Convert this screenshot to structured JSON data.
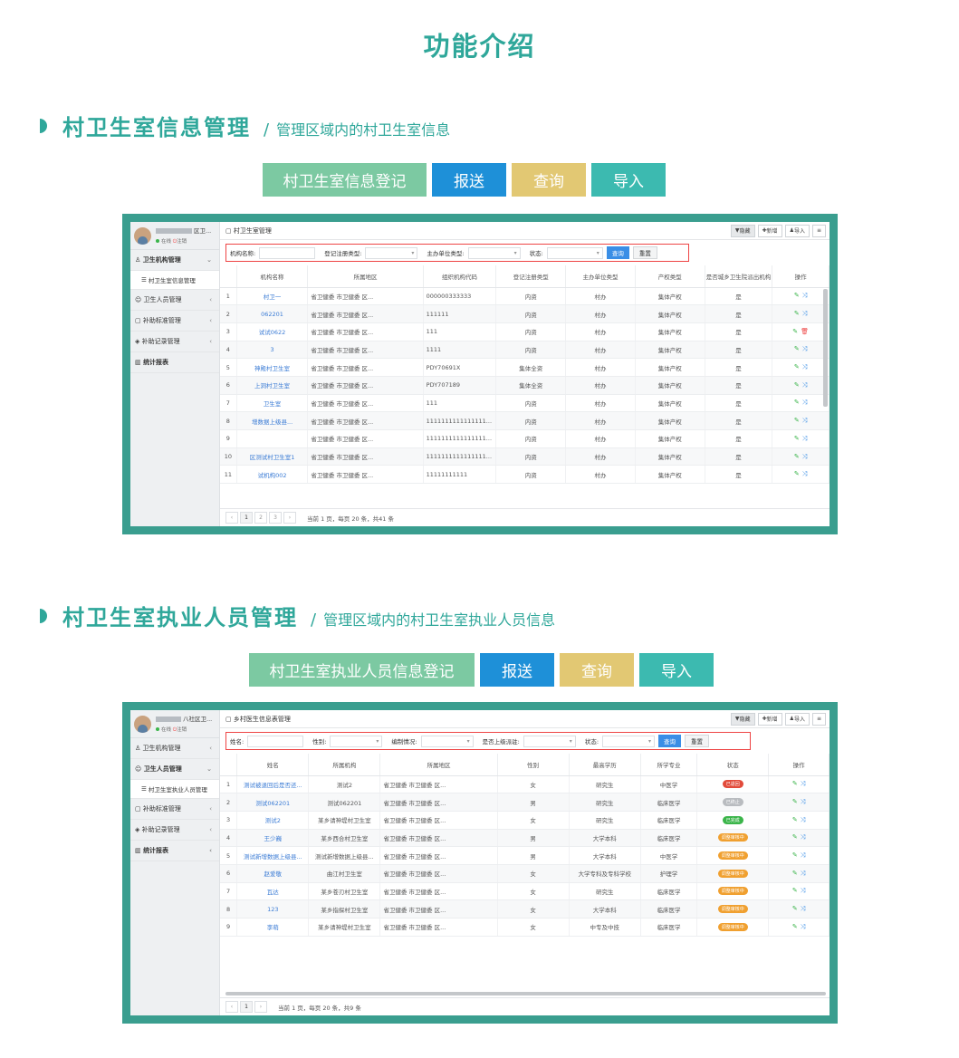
{
  "page_title": "功能介绍",
  "colors": {
    "teal": "#2fa79a",
    "green_btn": "#7cc9a2",
    "blue_btn": "#1e90d8",
    "yellow_btn": "#e2c873",
    "cyan_btn": "#3cbab0"
  },
  "section1": {
    "title": "村卫生室信息管理",
    "slash": "/",
    "subtitle": "管理区域内的村卫生室信息",
    "buttons": {
      "register": "村卫生室信息登记",
      "report": "报送",
      "query": "查询",
      "import": "导入"
    },
    "app": {
      "user": {
        "name": "区卫...",
        "online": "在线",
        "logout": "注销"
      },
      "menu": {
        "org_mgmt": "卫生机构管理",
        "org_sub": "村卫生室信息管理",
        "staff_mgmt": "卫生人员管理",
        "subsidy_std": "补助标准管理",
        "subsidy_rec": "补助记录管理",
        "stats": "统计报表"
      },
      "breadcrumb": "村卫生室管理",
      "toolbar": {
        "hide": "隐藏",
        "add": "新增",
        "import": "导入"
      },
      "filter": {
        "org_name": "机构名称:",
        "reg_type": "登记注册类型:",
        "unit_type": "主办单位类型:",
        "status": "状态:",
        "query": "查询",
        "reset": "重置"
      },
      "columns": [
        "",
        "机构名称",
        "所属地区",
        "组织机构代码",
        "登记注册类型",
        "主办单位类型",
        "产权类型",
        "是否城乡卫生院派出机构",
        "操作"
      ],
      "rows": [
        {
          "n": "1",
          "name": "村卫一",
          "region": "省卫健委 市卫健委 区...",
          "code": "000000333333",
          "reg": "内资",
          "unit": "村办",
          "prop": "集体产权",
          "sent": "是"
        },
        {
          "n": "2",
          "name": "062201",
          "region": "省卫健委 市卫健委 区...",
          "code": "111111",
          "reg": "内资",
          "unit": "村办",
          "prop": "集体产权",
          "sent": "是"
        },
        {
          "n": "3",
          "name": "试试0622",
          "region": "省卫健委 市卫健委 区...",
          "code": "111",
          "reg": "内资",
          "unit": "村办",
          "prop": "集体产权",
          "sent": "是"
        },
        {
          "n": "4",
          "name": "3",
          "region": "省卫健委 市卫健委 区...",
          "code": "1111",
          "reg": "内资",
          "unit": "村办",
          "prop": "集体产权",
          "sent": "是"
        },
        {
          "n": "5",
          "name": "神殿村卫生室",
          "region": "省卫健委 市卫健委 区...",
          "code": "PDY70691X",
          "reg": "集体全资",
          "unit": "村办",
          "prop": "集体产权",
          "sent": "是"
        },
        {
          "n": "6",
          "name": "上洞村卫生室",
          "region": "省卫健委 市卫健委 区...",
          "code": "PDY707189",
          "reg": "集体全资",
          "unit": "村办",
          "prop": "集体产权",
          "sent": "是"
        },
        {
          "n": "7",
          "name": "卫生室",
          "region": "省卫健委 市卫健委 区...",
          "code": "111",
          "reg": "内资",
          "unit": "村办",
          "prop": "集体产权",
          "sent": "是"
        },
        {
          "n": "8",
          "name": "增数据上级县...",
          "region": "省卫健委 市卫健委 区...",
          "code": "1111111111111111...",
          "reg": "内资",
          "unit": "村办",
          "prop": "集体产权",
          "sent": "是"
        },
        {
          "n": "9",
          "name": "",
          "region": "省卫健委 市卫健委 区...",
          "code": "1111111111111111...",
          "reg": "内资",
          "unit": "村办",
          "prop": "集体产权",
          "sent": "是"
        },
        {
          "n": "10",
          "name": "区测试村卫生室1",
          "region": "省卫健委 市卫健委 区...",
          "code": "1111111111111111...",
          "reg": "内资",
          "unit": "村办",
          "prop": "集体产权",
          "sent": "是"
        },
        {
          "n": "11",
          "name": "试机构002",
          "region": "省卫健委 市卫健委 区...",
          "code": "11111111111",
          "reg": "内资",
          "unit": "村办",
          "prop": "集体产权",
          "sent": "是"
        }
      ],
      "pager": {
        "prev": "‹",
        "p1": "1",
        "p2": "2",
        "p3": "3",
        "next": "›",
        "info": "当前 1 页，每页 20 条，共41 条"
      }
    }
  },
  "section2": {
    "title": "村卫生室执业人员管理",
    "slash": "/",
    "subtitle": "管理区域内的村卫生室执业人员信息",
    "buttons": {
      "register": "村卫生室执业人员信息登记",
      "report": "报送",
      "query": "查询",
      "import": "导入"
    },
    "app": {
      "user": {
        "name": "八社区卫...",
        "online": "在线",
        "logout": "注销"
      },
      "menu": {
        "org_mgmt": "卫生机构管理",
        "staff_mgmt": "卫生人员管理",
        "staff_sub": "村卫生室执业人员管理",
        "subsidy_std": "补助标准管理",
        "subsidy_rec": "补助记录管理",
        "stats": "统计报表"
      },
      "breadcrumb": "乡村医生信息表管理",
      "toolbar": {
        "hide": "隐藏",
        "add": "新增",
        "import": "导入"
      },
      "filter": {
        "name": "姓名:",
        "gender": "性别:",
        "staffing": "编制情况:",
        "upper": "是否上级派驻:",
        "status": "状态:",
        "query": "查询",
        "reset": "重置"
      },
      "columns": [
        "",
        "姓名",
        "所属机构",
        "所属地区",
        "性别",
        "最高学历",
        "所学专业",
        "状态",
        "操作"
      ],
      "rows": [
        {
          "n": "1",
          "name": "测试被退回后是否还...",
          "org": "测试2",
          "region": "省卫健委 市卫健委 区...",
          "sex": "女",
          "edu": "研究生",
          "major": "中医学",
          "status": "已退回",
          "sc": "#e24b3b"
        },
        {
          "n": "2",
          "name": "测试062201",
          "org": "测试062201",
          "region": "省卫健委 市卫健委 区...",
          "sex": "男",
          "edu": "研究生",
          "major": "临床医学",
          "status": "已终止",
          "sc": "#b9bcc0"
        },
        {
          "n": "3",
          "name": "测试2",
          "org": "某乡请神堤村卫生室",
          "region": "省卫健委 市卫健委 区...",
          "sex": "女",
          "edu": "研究生",
          "major": "临床医学",
          "status": "已完成",
          "sc": "#3bb54a"
        },
        {
          "n": "4",
          "name": "王少巍",
          "org": "某乡西合村卫生室",
          "region": "省卫健委 市卫健委 区...",
          "sex": "男",
          "edu": "大学本科",
          "major": "临床医学",
          "status": "调整审核中",
          "sc": "#f0a030"
        },
        {
          "n": "5",
          "name": "测试新增数据上级县...",
          "org": "测试新增数据上级县...",
          "region": "省卫健委 市卫健委 区...",
          "sex": "男",
          "edu": "大学本科",
          "major": "中医学",
          "status": "调整审核中",
          "sc": "#f0a030"
        },
        {
          "n": "6",
          "name": "赵爱敬",
          "org": "曲江村卫生室",
          "region": "省卫健委 市卫健委 区...",
          "sex": "女",
          "edu": "大学专科及专科学校",
          "major": "护理学",
          "status": "调整审核中",
          "sc": "#f0a030"
        },
        {
          "n": "7",
          "name": "瓦达",
          "org": "某乡苍刃村卫生室",
          "region": "省卫健委 市卫健委 区...",
          "sex": "女",
          "edu": "研究生",
          "major": "临床医学",
          "status": "调整审核中",
          "sc": "#f0a030"
        },
        {
          "n": "8",
          "name": "123",
          "org": "某乡指探村卫生室",
          "region": "省卫健委 市卫健委 区...",
          "sex": "女",
          "edu": "大学本科",
          "major": "临床医学",
          "status": "调整审核中",
          "sc": "#f0a030"
        },
        {
          "n": "9",
          "name": "李萌",
          "org": "某乡请神堤村卫生室",
          "region": "省卫健委 市卫健委 区...",
          "sex": "女",
          "edu": "中专及中技",
          "major": "临床医学",
          "status": "调整审核中",
          "sc": "#f0a030"
        }
      ],
      "pager": {
        "prev": "‹",
        "p1": "1",
        "next": "›",
        "info": "当前 1 页，每页 20 条，共9 条"
      }
    }
  }
}
